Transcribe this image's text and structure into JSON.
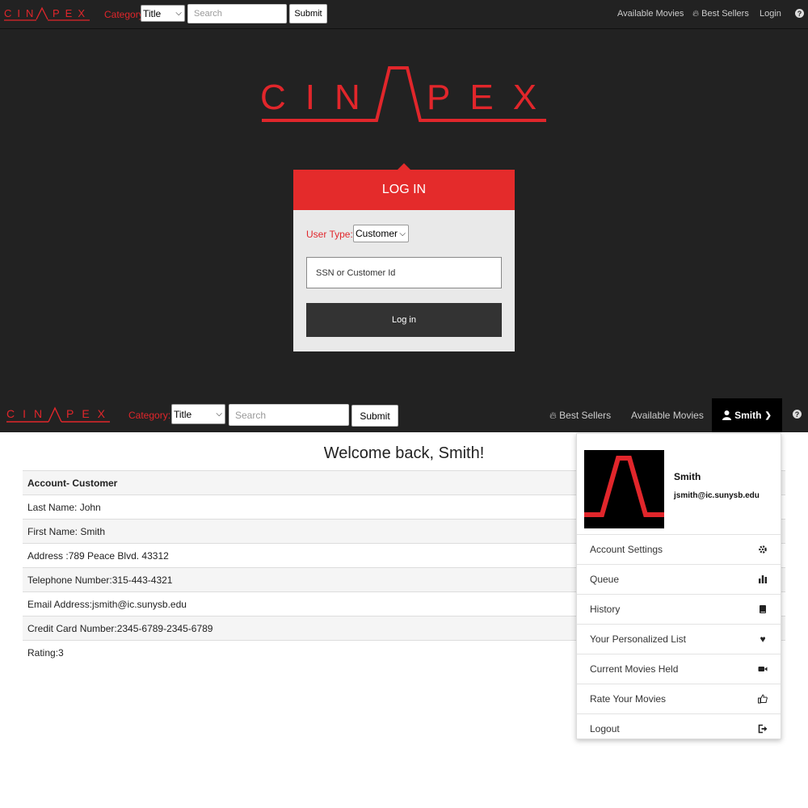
{
  "brand": {
    "logo_text": "CINAPEX",
    "accent_color": "#e1262b",
    "bar_color": "#222222"
  },
  "nav_top": {
    "category_label": "Category:",
    "category_value": "Title",
    "search_placeholder": "Search",
    "submit_label": "Submit",
    "links": [
      "Available Movies",
      "Best Sellers",
      "Login"
    ],
    "help_icon": "question-circle-icon"
  },
  "login": {
    "title": "LOG IN",
    "user_type_label": "User Type:",
    "user_type_value": "Customer",
    "id_placeholder": "SSN or Customer Id",
    "button_label": "Log in"
  },
  "nav_bottom": {
    "category_label": "Category:",
    "category_value": "Title",
    "search_placeholder": "Search",
    "submit_label": "Submit",
    "best_sellers": "Best Sellers",
    "available_movies": "Available Movies",
    "user": "Smith"
  },
  "account": {
    "welcome": "Welcome back, Smith!",
    "header": "Account- Customer",
    "rows": [
      "Last Name: John",
      "First Name: Smith",
      "Address :789 Peace Blvd. 43312",
      "Telephone Number:315-443-4321",
      "Email Address:jsmith@ic.sunysb.edu",
      "Credit Card Number:2345-6789-2345-6789",
      "Rating:3"
    ]
  },
  "profile": {
    "name": "Smith",
    "email": "jsmith@ic.sunysb.edu",
    "menu": [
      {
        "label": "Account Settings",
        "icon": "gear-icon"
      },
      {
        "label": "Queue",
        "icon": "bar-chart-icon"
      },
      {
        "label": "History",
        "icon": "book-icon"
      },
      {
        "label": "Your Personalized List",
        "icon": "heart-icon"
      },
      {
        "label": "Current Movies Held",
        "icon": "video-camera-icon"
      },
      {
        "label": "Rate Your Movies",
        "icon": "thumbs-up-icon"
      },
      {
        "label": "Logout",
        "icon": "logout-icon"
      }
    ]
  }
}
